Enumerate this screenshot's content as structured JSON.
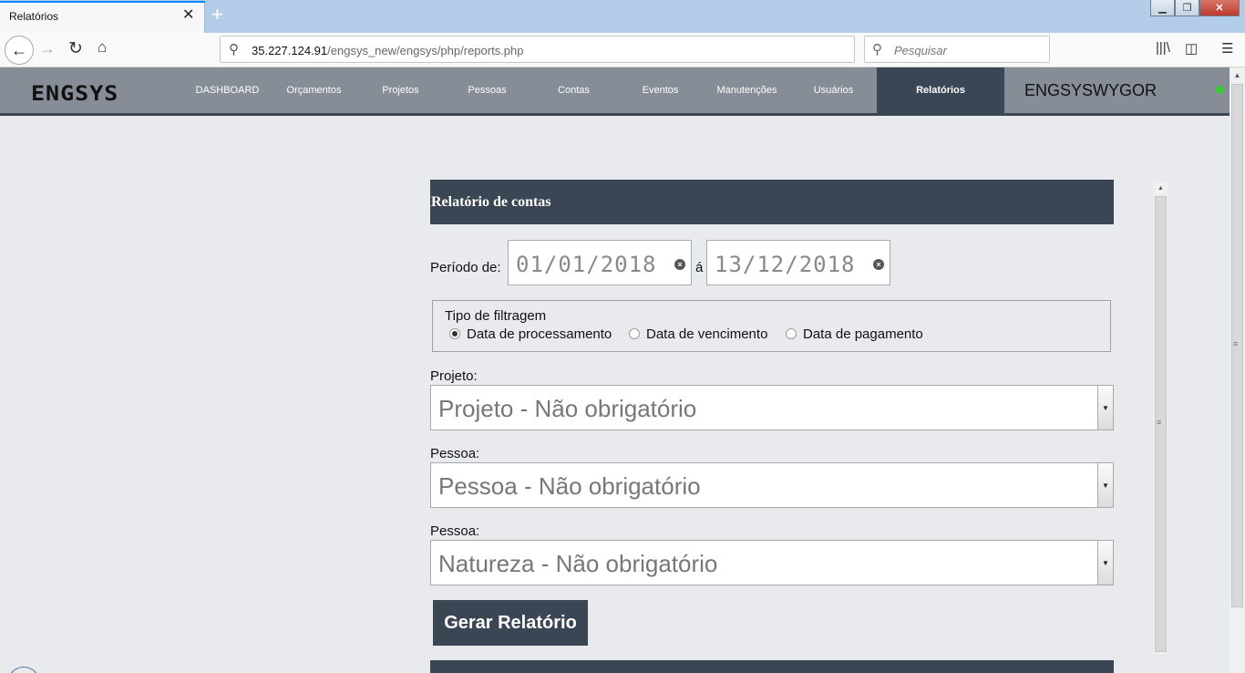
{
  "browser": {
    "tab_title": "Relatórios",
    "tab_close": "✕",
    "new_tab": "+",
    "url_host": "35.227.124.91",
    "url_path": "/engsys_new/engsys/php/reports.php",
    "search_placeholder": "Pesquisar"
  },
  "app": {
    "logo": "ENGSYS",
    "nav": [
      {
        "label": "DASHBOARD"
      },
      {
        "label": "Orçamentos"
      },
      {
        "label": "Projetos"
      },
      {
        "label": "Pessoas"
      },
      {
        "label": "Contas"
      },
      {
        "label": "Eventos"
      },
      {
        "label": "Manutenções"
      },
      {
        "label": "Usuários"
      },
      {
        "label": "Relatórios",
        "active": true
      }
    ],
    "username": "ENGSYSWYGOR",
    "status_color": "#33cc33"
  },
  "report": {
    "title": "Relatório de contas",
    "period_label": "Período de:",
    "period_sep": "á",
    "date_from": "01/01/2018",
    "date_to": "13/12/2018",
    "filter_legend": "Tipo de filtragem",
    "filter_options": [
      {
        "label": "Data de processamento",
        "checked": true
      },
      {
        "label": "Data de vencimento",
        "checked": false
      },
      {
        "label": "Data de pagamento",
        "checked": false
      }
    ],
    "projeto_label": "Projeto:",
    "projeto_value": "Projeto - Não obrigatório",
    "pessoa_label": "Pessoa:",
    "pessoa_value": "Pessoa - Não obrigatório",
    "natureza_label": "Pessoa:",
    "natureza_value": "Natureza - Não obrigatório",
    "submit_label": "Gerar Relatório"
  },
  "colors": {
    "header_dark": "#3b4654",
    "nav_bg": "#878d96",
    "page_bg": "#e8eaed"
  }
}
